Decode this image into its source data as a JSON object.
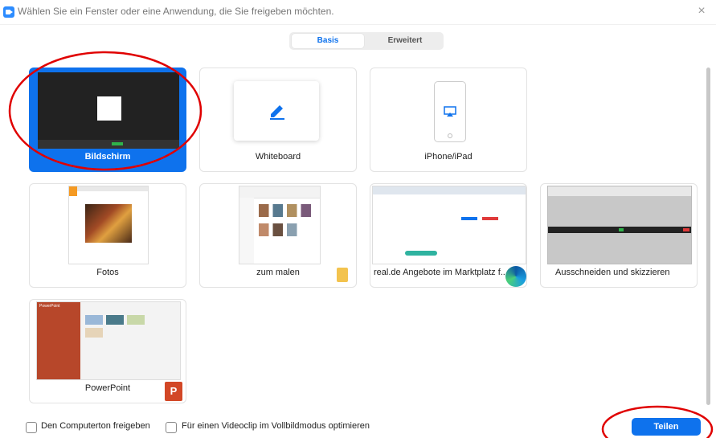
{
  "window": {
    "title": "Wählen Sie ein Fenster oder eine Anwendung, die Sie freigeben möchten.",
    "close_glyph": "×"
  },
  "tabs": [
    {
      "label": "Basis",
      "active": true
    },
    {
      "label": "Erweitert",
      "active": false
    }
  ],
  "tiles": [
    {
      "label": "Bildschirm",
      "selected": true
    },
    {
      "label": "Whiteboard",
      "selected": false
    },
    {
      "label": "iPhone/iPad",
      "selected": false
    },
    {
      "label": "Fotos",
      "selected": false
    },
    {
      "label": "zum malen",
      "selected": false
    },
    {
      "label": "real.de Angebote im Marktplatz f...",
      "selected": false
    },
    {
      "label": "Ausschneiden und skizzieren",
      "selected": false
    },
    {
      "label": "PowerPoint",
      "selected": false
    }
  ],
  "thumb_text": {
    "powerpoint_header": "PowerPoint"
  },
  "footer": {
    "checkbox_audio": "Den Computerton freigeben",
    "checkbox_video": "Für einen Videoclip im Vollbildmodus optimieren",
    "share_label": "Teilen"
  },
  "colors": {
    "accent": "#0e72ed",
    "annotation": "#e00000",
    "powerpoint": "#b7472a"
  },
  "icons": [
    "zoom-app-icon",
    "close-icon",
    "pencil-icon",
    "airplay-icon",
    "folder-icon",
    "edge-icon",
    "powerpoint-icon"
  ]
}
